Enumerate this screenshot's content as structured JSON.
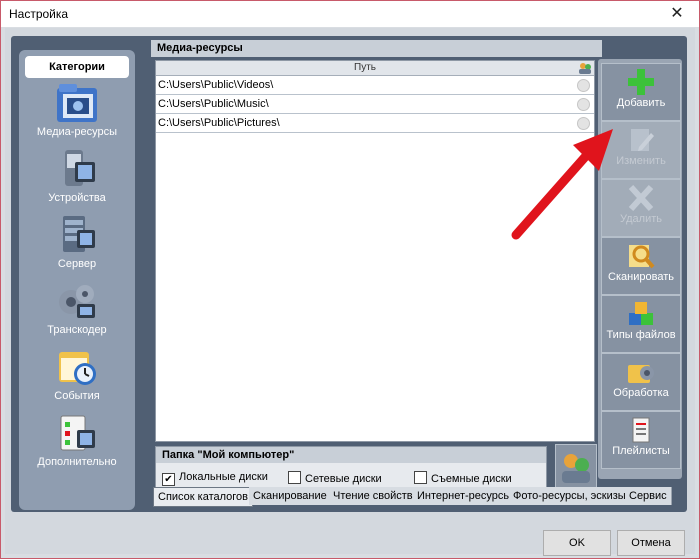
{
  "window": {
    "title": "Настройка",
    "close_symbol": "✕"
  },
  "sidebar": {
    "header": "Категории",
    "items": [
      {
        "label": "Медиа-ресурсы",
        "icon": "media-folder-icon"
      },
      {
        "label": "Устройства",
        "icon": "devices-icon"
      },
      {
        "label": "Сервер",
        "icon": "server-icon"
      },
      {
        "label": "Транскодер",
        "icon": "transcoder-icon"
      },
      {
        "label": "События",
        "icon": "events-icon"
      },
      {
        "label": "Дополнительно",
        "icon": "additional-icon"
      }
    ]
  },
  "panel": {
    "title": "Медиа-ресурсы",
    "column_header": "Путь",
    "paths": [
      "C:\\Users\\Public\\Videos\\",
      "C:\\Users\\Public\\Music\\",
      "C:\\Users\\Public\\Pictures\\"
    ]
  },
  "toolbar": {
    "buttons": [
      {
        "label": "Добавить",
        "icon": "add-icon",
        "enabled": true
      },
      {
        "label": "Изменить",
        "icon": "edit-icon",
        "enabled": false
      },
      {
        "label": "Удалить",
        "icon": "delete-icon",
        "enabled": false
      },
      {
        "label": "Сканировать",
        "icon": "scan-icon",
        "enabled": true
      },
      {
        "label": "Типы файлов",
        "icon": "file-types-icon",
        "enabled": true
      },
      {
        "label": "Обработка",
        "icon": "processing-icon",
        "enabled": true
      },
      {
        "label": "Плейлисты",
        "icon": "playlists-icon",
        "enabled": true
      }
    ]
  },
  "my_computer": {
    "title": "Папка \"Мой компьютер\"",
    "local_label": "Локальные диски",
    "local_checked": true,
    "network_label": "Сетевые диски",
    "network_checked": false,
    "removable_label": "Съемные диски",
    "removable_checked": false
  },
  "tabs": [
    "Список каталогов",
    "Сканирование",
    "Чтение свойств",
    "Интернет-ресурсы",
    "Фото-ресурсы, эскизы",
    "Сервис"
  ],
  "footer": {
    "ok_label": "OK",
    "cancel_label": "Отмена"
  },
  "colors": {
    "sidebar_bg": "#8f9db0",
    "outer_bg": "#505f73",
    "arrow": "#e0141c",
    "add_green": "#3cc23a"
  }
}
